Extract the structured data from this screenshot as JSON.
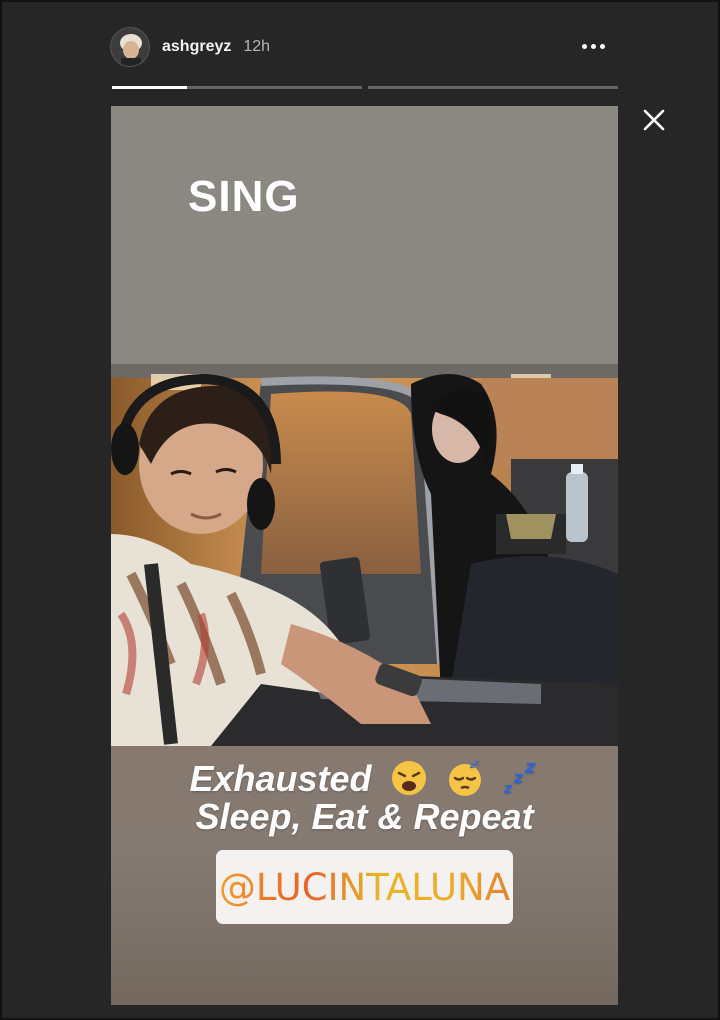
{
  "header": {
    "username": "ashgreyz",
    "timestamp": "12h"
  },
  "progress": {
    "segments": 2,
    "current_segment_fill_fraction": 0.3
  },
  "story": {
    "top_text": "SING",
    "caption": {
      "line1": "Exhausted",
      "line1_emojis": [
        "weary-face-emoji",
        "sleepy-face-emoji",
        "zzz-emoji"
      ],
      "line2": "Sleep, Eat & Repeat"
    },
    "mention": "@LUCINTALUNA"
  },
  "colors": {
    "background": "#262626",
    "mention_gradient": [
      "#f29b2b",
      "#e8622a",
      "#e8b526",
      "#e4832c"
    ],
    "zzz": "#2b63d9"
  }
}
